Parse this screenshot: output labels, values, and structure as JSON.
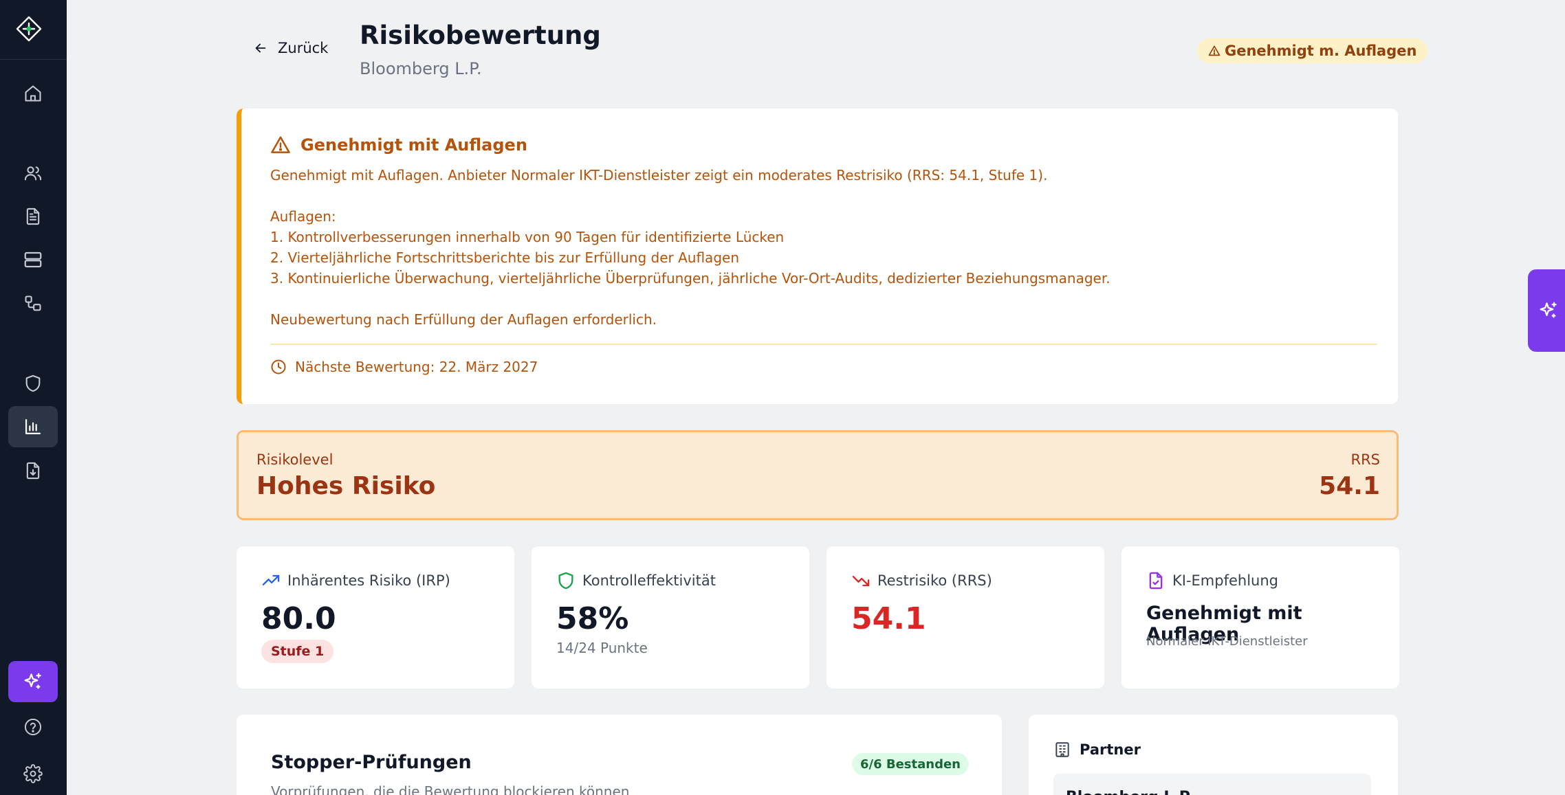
{
  "header": {
    "back_label": "Zurück",
    "title": "Risikobewertung",
    "subtitle": "Bloomberg L.P.",
    "status_badge": "Genehmigt m. Auflagen"
  },
  "alert": {
    "title": "Genehmigt mit Auflagen",
    "body": "Genehmigt mit Auflagen. Anbieter Normaler IKT-Dienstleister zeigt ein moderates Restrisiko (RRS: 54.1, Stufe 1).\n\nAuflagen:\n1. Kontrollverbesserungen innerhalb von 90 Tagen für identifizierte Lücken\n2. Vierteljährliche Fortschrittsberichte bis zur Erfüllung der Auflagen\n3. Kontinuierliche Überwachung, vierteljährliche Überprüfungen, jährliche Vor-Ort-Audits, dedizierter Beziehungsmanager.\n\nNeubewertung nach Erfüllung der Auflagen erforderlich.",
    "next_review": "Nächste Bewertung: 22. März 2027"
  },
  "risk_level": {
    "label": "Risikolevel",
    "value": "Hohes Risiko",
    "rrs_label": "RRS",
    "rrs_value": "54.1"
  },
  "metrics": {
    "inherent": {
      "label": "Inhärentes Risiko (IRP)",
      "value": "80.0",
      "pill": "Stufe 1"
    },
    "control": {
      "label": "Kontrolleffektivität",
      "value": "58%",
      "sub": "14/24 Punkte"
    },
    "residual": {
      "label": "Restrisiko (RRS)",
      "value": "54.1"
    },
    "ai": {
      "label": "KI-Empfehlung",
      "value": "Genehmigt mit Auflagen",
      "sub": "Normaler IKT-Dienstleister"
    }
  },
  "stopper": {
    "title": "Stopper-Prüfungen",
    "badge": "6/6 Bestanden",
    "description": "Vorprüfungen, die die Bewertung blockieren können"
  },
  "partner": {
    "title": "Partner",
    "name": "Bloomberg L.P."
  },
  "colors": {
    "sidebar_bg": "#111827",
    "accent_purple": "#7c3aed",
    "warning_amber": "#f59e0b",
    "warning_text": "#b45309",
    "risk_text": "#9a3412",
    "danger_red": "#dc2626",
    "success_green": "#166534"
  },
  "icons": {
    "sidebar": [
      "logo-icon",
      "home-icon",
      "users-icon",
      "document-icon",
      "server-icon",
      "workflow-icon",
      "shield-icon",
      "bar-chart-icon",
      "file-download-icon",
      "sparkles-icon",
      "help-icon",
      "settings-icon"
    ]
  }
}
